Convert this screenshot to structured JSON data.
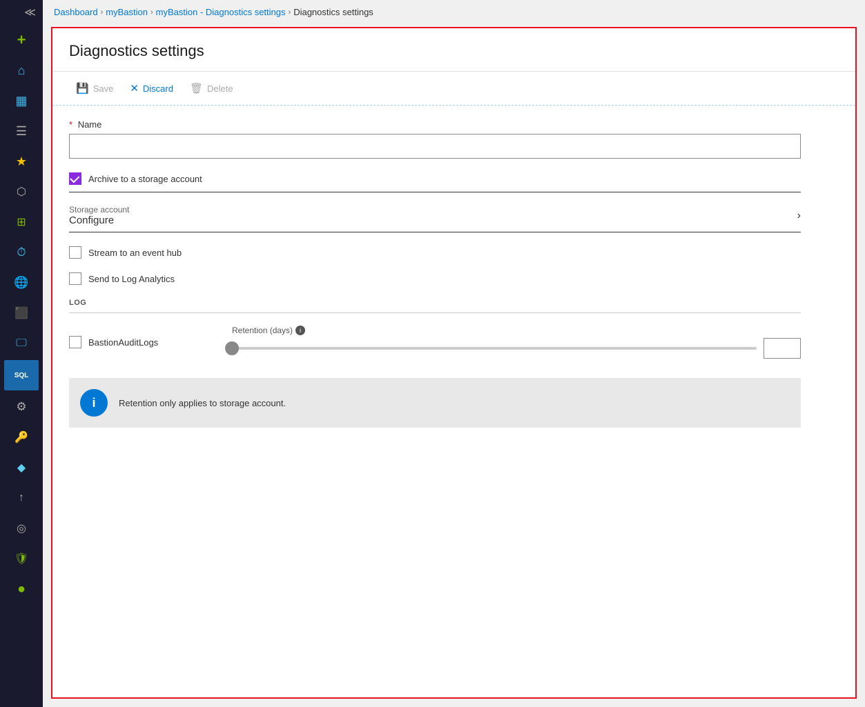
{
  "breadcrumb": {
    "items": [
      {
        "label": "Dashboard",
        "link": true
      },
      {
        "label": "myBastion",
        "link": true
      },
      {
        "label": "myBastion - Diagnostics settings",
        "link": true
      },
      {
        "label": "Diagnostics settings",
        "link": false
      }
    ]
  },
  "panel": {
    "title": "Diagnostics settings",
    "toolbar": {
      "save_label": "Save",
      "discard_label": "Discard",
      "delete_label": "Delete"
    },
    "form": {
      "name_label": "Name",
      "name_required": true,
      "name_placeholder": "",
      "archive_label": "Archive to a storage account",
      "archive_checked": true,
      "storage_account_label": "Storage account",
      "storage_account_value": "Configure",
      "stream_label": "Stream to an event hub",
      "stream_checked": false,
      "log_analytics_label": "Send to Log Analytics",
      "log_analytics_checked": false,
      "log_section_title": "LOG",
      "log_entry_label": "BastionAuditLogs",
      "log_entry_checked": false,
      "retention_label": "Retention (days)",
      "retention_value": "0",
      "info_text": "Retention only applies to storage account."
    }
  },
  "sidebar": {
    "expand_icon": "≫",
    "add_icon": "+",
    "icons": [
      {
        "name": "home-icon",
        "symbol": "🏠",
        "color": "#40b4e5"
      },
      {
        "name": "portal-icon",
        "symbol": "⊞",
        "color": "#40b4e5"
      },
      {
        "name": "menu-icon",
        "symbol": "☰",
        "color": "#aaa"
      },
      {
        "name": "favorites-icon",
        "symbol": "★",
        "color": "#f0c000"
      },
      {
        "name": "resources-icon",
        "symbol": "⬡",
        "color": "#aaa"
      },
      {
        "name": "dashboard-icon",
        "symbol": "⊞",
        "color": "#7fba00"
      },
      {
        "name": "clock-icon",
        "symbol": "🕐",
        "color": "#40b4e5"
      },
      {
        "name": "network-icon",
        "symbol": "🌐",
        "color": "#40b4e5"
      },
      {
        "name": "box-icon",
        "symbol": "📦",
        "color": "#40b4e5"
      },
      {
        "name": "monitor-icon",
        "symbol": "🖥",
        "color": "#40b4e5"
      },
      {
        "name": "sql-icon",
        "symbol": "SQL",
        "color": "#40b4e5"
      },
      {
        "name": "settings-icon",
        "symbol": "⚙",
        "color": "#aaa"
      },
      {
        "name": "key-icon",
        "symbol": "🔑",
        "color": "#f0c000"
      },
      {
        "name": "diamond-icon",
        "symbol": "◆",
        "color": "#60d0f0"
      },
      {
        "name": "upload-icon",
        "symbol": "↑",
        "color": "#aaa"
      },
      {
        "name": "circle-icon",
        "symbol": "◎",
        "color": "#aaa"
      },
      {
        "name": "shield-icon",
        "symbol": "🛡",
        "color": "#7fba00"
      },
      {
        "name": "dot-icon",
        "symbol": "●",
        "color": "#7fba00"
      }
    ]
  }
}
